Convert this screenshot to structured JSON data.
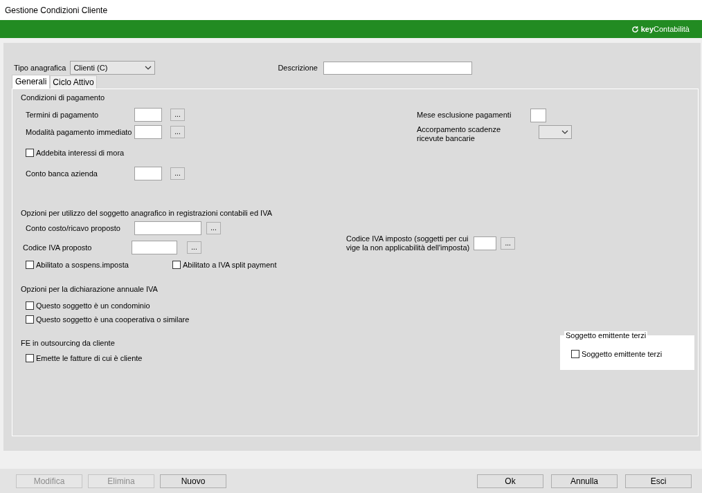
{
  "window": {
    "title": "Gestione Condizioni Cliente"
  },
  "brand": {
    "prefix": "key",
    "name": "Contabilità"
  },
  "header": {
    "tipo_anagrafica": {
      "label": "Tipo anagrafica",
      "value": "Clienti (C)"
    },
    "descrizione": {
      "label": "Descrizione"
    }
  },
  "tabs": [
    {
      "label": "Generali",
      "selected": true
    },
    {
      "label": "Ciclo Attivo",
      "selected": false
    }
  ],
  "condizioni_pagamento": {
    "title": "Condizioni di pagamento",
    "left": [
      {
        "kind": "lookup",
        "label": "Termini di pagamento"
      },
      {
        "kind": "lookup",
        "label": "Modalità pagamento immediato"
      },
      {
        "kind": "checkbox",
        "label": "Addebita interessi di mora",
        "checked": false
      },
      {
        "kind": "lookup",
        "label": "Conto banca azienda"
      }
    ],
    "right": [
      {
        "kind": "input",
        "lines": [
          "Mese esclusione pagamenti"
        ]
      },
      {
        "kind": "select",
        "lines": [
          "Accorpamento scadenze",
          "ricevute bancarie"
        ]
      }
    ]
  },
  "opzioni_registrazioni": {
    "title": "Opzioni per utilizzo del soggetto anagrafico in registrazioni contabili ed IVA",
    "left": [
      {
        "kind": "lookup",
        "label": "Conto costo/ricavo proposto"
      },
      {
        "kind": "lookup",
        "label": "Codice IVA proposto"
      },
      {
        "kind": "checks",
        "items": [
          {
            "label": "Abilitato a sospens.imposta",
            "checked": false
          },
          {
            "label": "Abilitato a IVA split payment",
            "checked": false
          }
        ]
      }
    ],
    "right": [
      {
        "kind": "lookup",
        "lines": [
          "Codice IVA imposto (soggetti per cui",
          "vige la non applicabilità dell'imposta)"
        ]
      }
    ]
  },
  "dichiarazione_iva": {
    "title": "Opzioni per la dichiarazione annuale IVA",
    "left": [
      {
        "kind": "checkbox",
        "label": "Questo soggetto è un condominio",
        "checked": false
      },
      {
        "kind": "checkbox",
        "label": "Questo soggetto è una cooperativa o similare",
        "checked": false
      }
    ]
  },
  "fe_outsourcing": {
    "title": "FE in outsourcing da cliente",
    "left": [
      {
        "kind": "checkbox",
        "label": "Emette le fatture di cui è cliente",
        "checked": false
      }
    ],
    "group": {
      "title": "Soggetto emittente terzi",
      "checkbox": {
        "label": "Soggetto emittente terzi",
        "checked": false
      }
    }
  },
  "lookup_button": "...",
  "buttons_left": [
    {
      "label": "Modifica",
      "disabled": true
    },
    {
      "label": "Elimina",
      "disabled": true
    },
    {
      "label": "Nuovo",
      "disabled": false
    }
  ],
  "buttons_right": [
    {
      "label": "Ok",
      "disabled": false
    },
    {
      "label": "Annulla",
      "disabled": false
    },
    {
      "label": "Esci",
      "disabled": false
    }
  ]
}
